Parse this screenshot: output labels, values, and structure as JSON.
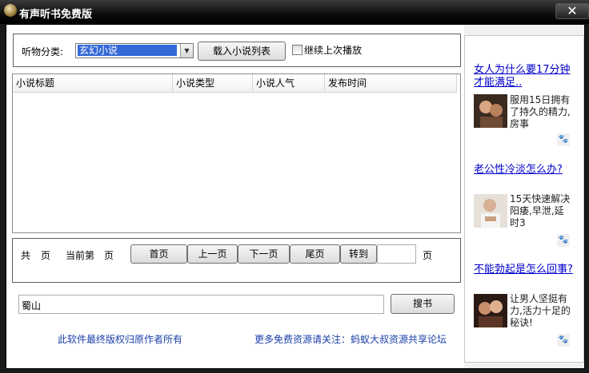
{
  "window": {
    "title": "有声听书免费版",
    "close_glyph": "✕"
  },
  "category": {
    "label": "听物分类:",
    "selected": "玄幻小说",
    "load_button": "载入小说列表",
    "continue_label": "继续上次播放",
    "continue_checked": false
  },
  "list": {
    "columns": [
      "小说标题",
      "小说类型",
      "小说人气",
      "发布时间"
    ],
    "rows": []
  },
  "paging": {
    "total_prefix": "共",
    "total_suffix": "页",
    "current_prefix": "当前第",
    "current_suffix": "页",
    "first": "首页",
    "prev": "上一页",
    "next": "下一页",
    "last": "尾页",
    "goto": "转到",
    "goto_value": "",
    "goto_suffix": "页"
  },
  "search": {
    "value": "蜀山",
    "button": "搜书"
  },
  "footer": {
    "copyright": "此软件最终版权归原作者所有",
    "more": "更多免费资源请关注：蚂蚁大叔资源共享论坛"
  },
  "ads": [
    {
      "title": "女人为什么要17分钟才能满足..",
      "desc": "服用15日拥有了持久的精力,房事",
      "icon": "paw-icon"
    },
    {
      "title": "老公性冷淡怎么办?",
      "desc": "15天快速解决阳痿,早泄,延时3",
      "icon": "paw-icon"
    },
    {
      "title": "不能勃起是怎么回事?",
      "desc": "让男人坚挺有力,活力十足的秘诀!",
      "icon": "paw-icon"
    }
  ]
}
